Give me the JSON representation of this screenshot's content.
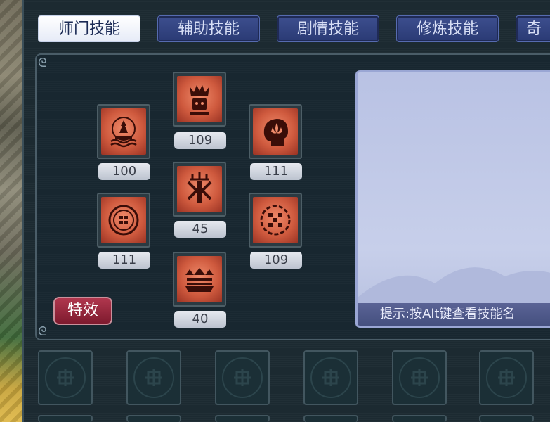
{
  "tabs": [
    "师门技能",
    "辅助技能",
    "剧情技能",
    "修炼技能",
    "奇"
  ],
  "active_tab": "师门技能",
  "skills": [
    {
      "level": "100",
      "icon": "pagoda-icon"
    },
    {
      "level": "109",
      "icon": "crown-face-icon"
    },
    {
      "level": "111",
      "icon": "head-icon"
    },
    {
      "level": "45",
      "icon": "trident-icon"
    },
    {
      "level": "111",
      "icon": "coin-icon"
    },
    {
      "level": "109",
      "icon": "dice-orb-icon"
    },
    {
      "level": "40",
      "icon": "spikes-icon"
    }
  ],
  "effect_button": "特效",
  "hint": "提示:按Alt键查看技能名",
  "colors": {
    "panel_bg": "#1c2a31",
    "tab_bg": "#2a3a74",
    "tab_active_bg": "#ffffff",
    "skill_icon": "#cf5a3e",
    "effect_button": "#8e2338",
    "desc_bg": "#c0c8e8",
    "hint_bar": "#4b5585"
  }
}
